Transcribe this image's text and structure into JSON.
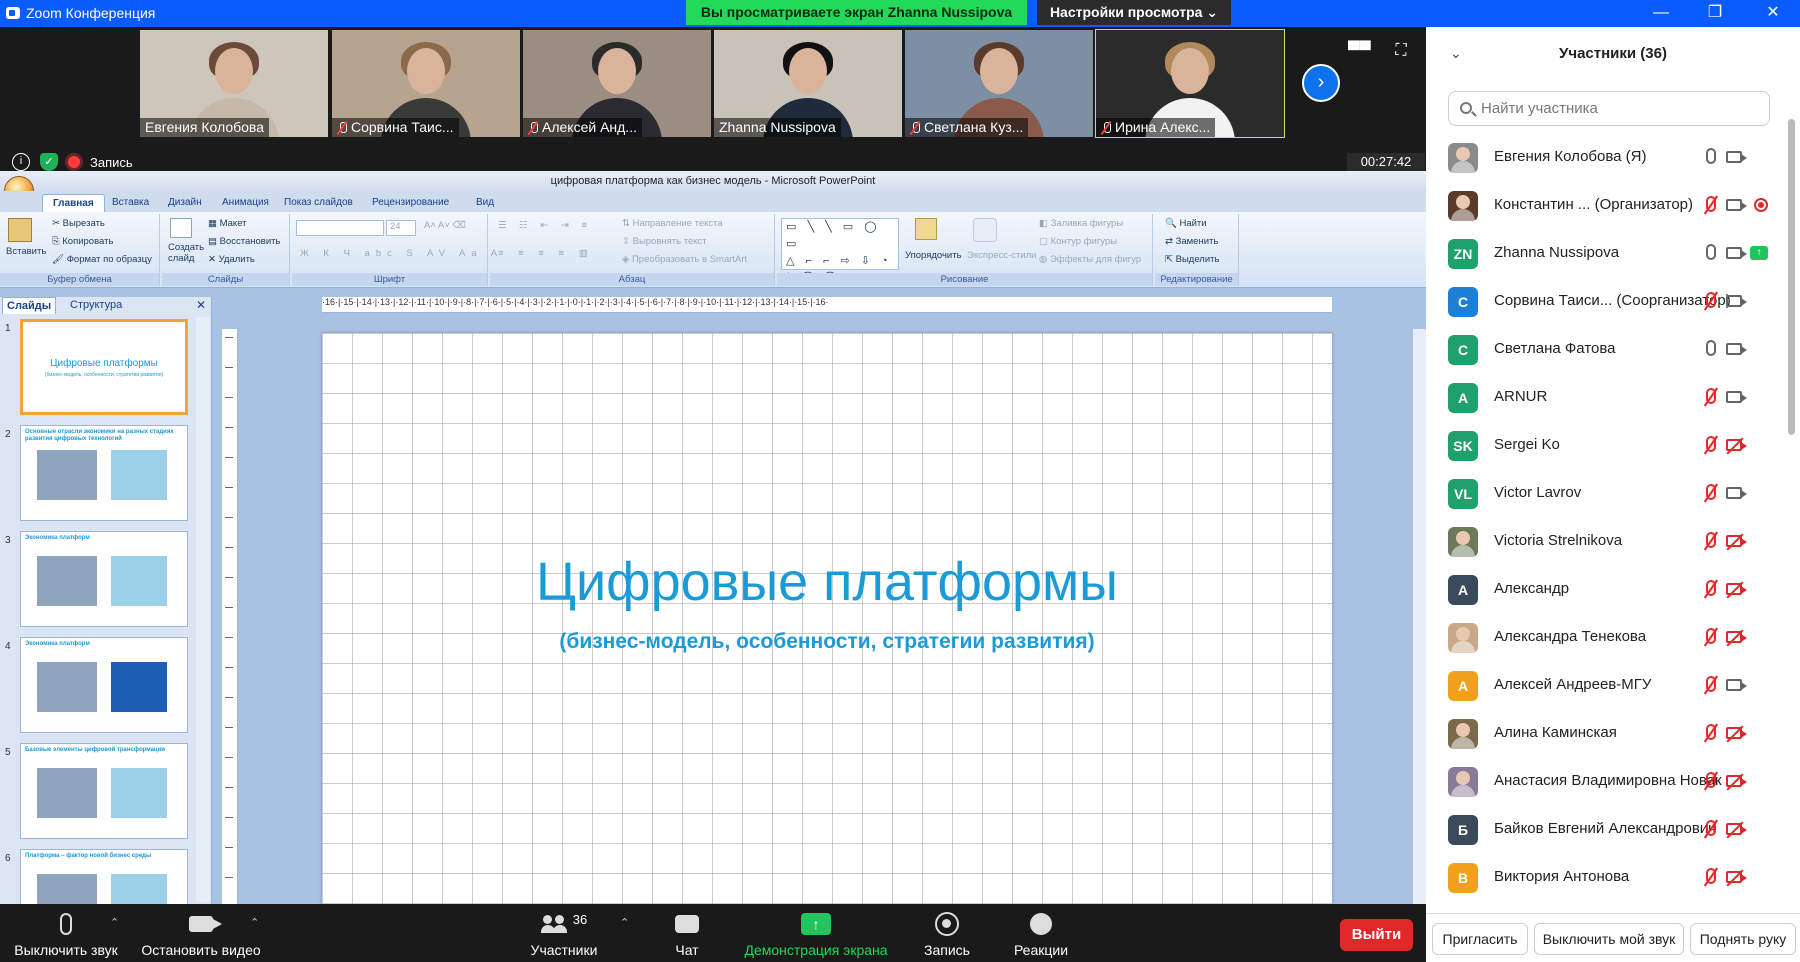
{
  "window": {
    "title": "Zoom Конференция",
    "min": "—",
    "restore": "❐",
    "close": "✕"
  },
  "share_banner": "Вы просматриваете экран Zhanna Nussipova",
  "view_options": "Настройки просмотра ⌄",
  "gallery": {
    "tiles": [
      {
        "name": "Евгения Колобова",
        "muted": false,
        "hair": "#6b4a3a",
        "shirt": "#c8b8a8",
        "bg": "#cfc6bb"
      },
      {
        "name": "Сорвина Таис...",
        "muted": true,
        "hair": "#8a6a4a",
        "shirt": "#3a3a3a",
        "bg": "#b7a48e"
      },
      {
        "name": "Алексей Анд...",
        "muted": true,
        "hair": "#2a2a2a",
        "shirt": "#2a2a30",
        "bg": "#9b8d82"
      },
      {
        "name": "Zhanna Nussipova",
        "muted": false,
        "hair": "#111111",
        "shirt": "#1f2a3a",
        "bg": "#c9c2b8"
      },
      {
        "name": "Светлана Куз...",
        "muted": true,
        "hair": "#5a3a2a",
        "shirt": "#8a5a4a",
        "bg": "#7d8fa3"
      },
      {
        "name": "Ирина Алекс...",
        "muted": true,
        "hair": "#b08a5a",
        "shirt": "#f2f2f2",
        "bg": "#2b2b2b"
      }
    ],
    "next_icon": "›"
  },
  "recording": {
    "label": "Запись",
    "timer": "00:27:42"
  },
  "ppt": {
    "title": "цифровая платформа как бизнес модель - Microsoft PowerPoint",
    "tabs": [
      "Главная",
      "Вставка",
      "Дизайн",
      "Анимация",
      "Показ слайдов",
      "Рецензирование",
      "Вид"
    ],
    "clipboard": {
      "paste": "Вставить",
      "cut": "Вырезать",
      "copy": "Копировать",
      "format": "Формат по образцу",
      "label": "Буфер обмена"
    },
    "slides_grp": {
      "new": "Создать слайд",
      "layout": "Макет",
      "reset": "Восстановить",
      "delete": "Удалить",
      "label": "Слайды"
    },
    "font_grp": {
      "size": "24",
      "label": "Шрифт"
    },
    "para_grp": {
      "dir": "Направление текста",
      "align": "Выровнять текст",
      "smart": "Преобразовать в SmartArt",
      "label": "Абзац"
    },
    "draw_grp": {
      "arrange": "Упорядочить",
      "styles": "Экспресс-стили",
      "fill": "Заливка фигуры",
      "outline": "Контур фигуры",
      "effects": "Эффекты для фигур",
      "label": "Рисование"
    },
    "edit_grp": {
      "find": "Найти",
      "replace": "Заменить",
      "select": "Выделить",
      "label": "Редактирование"
    },
    "pane_tabs": [
      "Слайды",
      "Структура"
    ],
    "ruler": "·16·|·15·|·14·|·13·|·12·|·11·|·10·|·9·|·8·|·7·|·6·|·5·|·4·|·3·|·2·|·1·|·0·|·1·|·2·|·3·|·4·|·5·|·6·|·7·|·8·|·9·|·10·|·11·|·12·|·13·|·14·|·15·|·16·",
    "thumbs": [
      {
        "num": "1",
        "title": "Цифровые платформы",
        "sub": "(бизнес-модель, особенности, стратегии развития)"
      },
      {
        "num": "2",
        "title": "Основные отрасли экономики на разных стадиях развития цифровых технологий",
        "sub": ""
      },
      {
        "num": "3",
        "title": "Экономика платформ",
        "sub": ""
      },
      {
        "num": "4",
        "title": "Экономика платформ",
        "sub": ""
      },
      {
        "num": "5",
        "title": "Базовые элементы цифровой трансформации",
        "sub": ""
      },
      {
        "num": "6",
        "title": "Платформа – фактор новой бизнес среды",
        "sub": ""
      }
    ],
    "slide": {
      "title": "Цифровые платформы",
      "subtitle": "(бизнес-модель, особенности, стратегии развития)"
    }
  },
  "toolbar": {
    "mute": "Выключить звук",
    "video": "Остановить видео",
    "participants": "Участники",
    "participants_count": "36",
    "chat": "Чат",
    "share": "Демонстрация экрана",
    "record": "Запись",
    "reactions": "Реакции",
    "leave": "Выйти"
  },
  "panel": {
    "title": "Участники (36)",
    "search_placeholder": "Найти участника",
    "participants": [
      {
        "name": "Евгения Колобова (Я)",
        "role": "",
        "initials": "",
        "color": "#8b8b8b",
        "photo": true,
        "mic": "on",
        "video": "on",
        "extra": ""
      },
      {
        "name": "Константин ...",
        "role": "(Организатор)",
        "initials": "",
        "color": "#5a3a2a",
        "photo": true,
        "mic": "off",
        "video": "on",
        "extra": "rec"
      },
      {
        "name": "Zhanna Nussipova",
        "role": "",
        "initials": "ZN",
        "color": "#20a06a",
        "photo": false,
        "mic": "on",
        "video": "on",
        "extra": "share"
      },
      {
        "name": "Сорвина Таиси...",
        "role": "(Соорганизатор)",
        "initials": "С",
        "color": "#1e7fd6",
        "photo": false,
        "mic": "off",
        "video": "on",
        "extra": ""
      },
      {
        "name": "Светлана Фатова",
        "role": "",
        "initials": "С",
        "color": "#20a06a",
        "photo": false,
        "mic": "on",
        "video": "on",
        "extra": ""
      },
      {
        "name": "ARNUR",
        "role": "",
        "initials": "A",
        "color": "#20a06a",
        "photo": false,
        "mic": "off",
        "video": "on",
        "extra": ""
      },
      {
        "name": "Sergei Ko",
        "role": "",
        "initials": "SK",
        "color": "#20a06a",
        "photo": false,
        "mic": "off",
        "video": "off",
        "extra": ""
      },
      {
        "name": "Victor Lavrov",
        "role": "",
        "initials": "VL",
        "color": "#20a06a",
        "photo": false,
        "mic": "off",
        "video": "on",
        "extra": ""
      },
      {
        "name": "Victoria Strelnikova",
        "role": "",
        "initials": "",
        "color": "#6a7a5a",
        "photo": true,
        "mic": "off",
        "video": "off",
        "extra": ""
      },
      {
        "name": "Александр",
        "role": "",
        "initials": "A",
        "color": "#3a4a5a",
        "photo": false,
        "mic": "off",
        "video": "off",
        "extra": ""
      },
      {
        "name": "Александра Тенекова",
        "role": "",
        "initials": "",
        "color": "#c9a88a",
        "photo": true,
        "mic": "off",
        "video": "off",
        "extra": ""
      },
      {
        "name": "Алексей Андреев-МГУ",
        "role": "",
        "initials": "A",
        "color": "#f0a01a",
        "photo": false,
        "mic": "off",
        "video": "on",
        "extra": ""
      },
      {
        "name": "Алина Каминская",
        "role": "",
        "initials": "",
        "color": "#7a6a4a",
        "photo": true,
        "mic": "off",
        "video": "off",
        "extra": ""
      },
      {
        "name": "Анастасия Владимировна Новак",
        "role": "",
        "initials": "",
        "color": "#8a7a9a",
        "photo": true,
        "mic": "off",
        "video": "off",
        "extra": ""
      },
      {
        "name": "Байков Евгений Александрович",
        "role": "",
        "initials": "Б",
        "color": "#3a4a5a",
        "photo": false,
        "mic": "off",
        "video": "off",
        "extra": ""
      },
      {
        "name": "Виктория Антонова",
        "role": "",
        "initials": "В",
        "color": "#f0a01a",
        "photo": false,
        "mic": "off",
        "video": "off",
        "extra": ""
      }
    ],
    "invite": "Пригласить",
    "mute_me": "Выключить мой звук",
    "raise_hand": "Поднять руку"
  }
}
